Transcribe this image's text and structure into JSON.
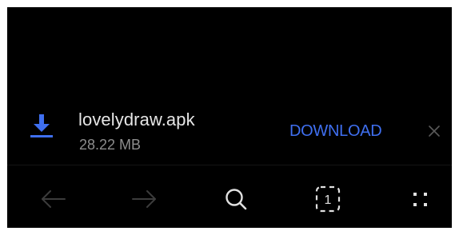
{
  "download_banner": {
    "file_name": "lovelydraw.apk",
    "file_size": "28.22 MB",
    "download_label": "DOWNLOAD",
    "icons": {
      "download": "download-arrow-icon",
      "close": "close-icon"
    }
  },
  "bottom_nav": {
    "tab_count": "1",
    "icons": {
      "back": "back-arrow-icon",
      "forward": "forward-arrow-icon",
      "search": "search-icon",
      "tabs": "tabs-icon",
      "menu": "menu-dots-icon"
    }
  },
  "colors": {
    "background": "#000000",
    "accent": "#3f6ff0",
    "text_primary": "#e6e6e6",
    "text_secondary": "#8d8d8d",
    "icon_disabled": "#3c3c3c",
    "icon_active": "#e0e0e0"
  }
}
